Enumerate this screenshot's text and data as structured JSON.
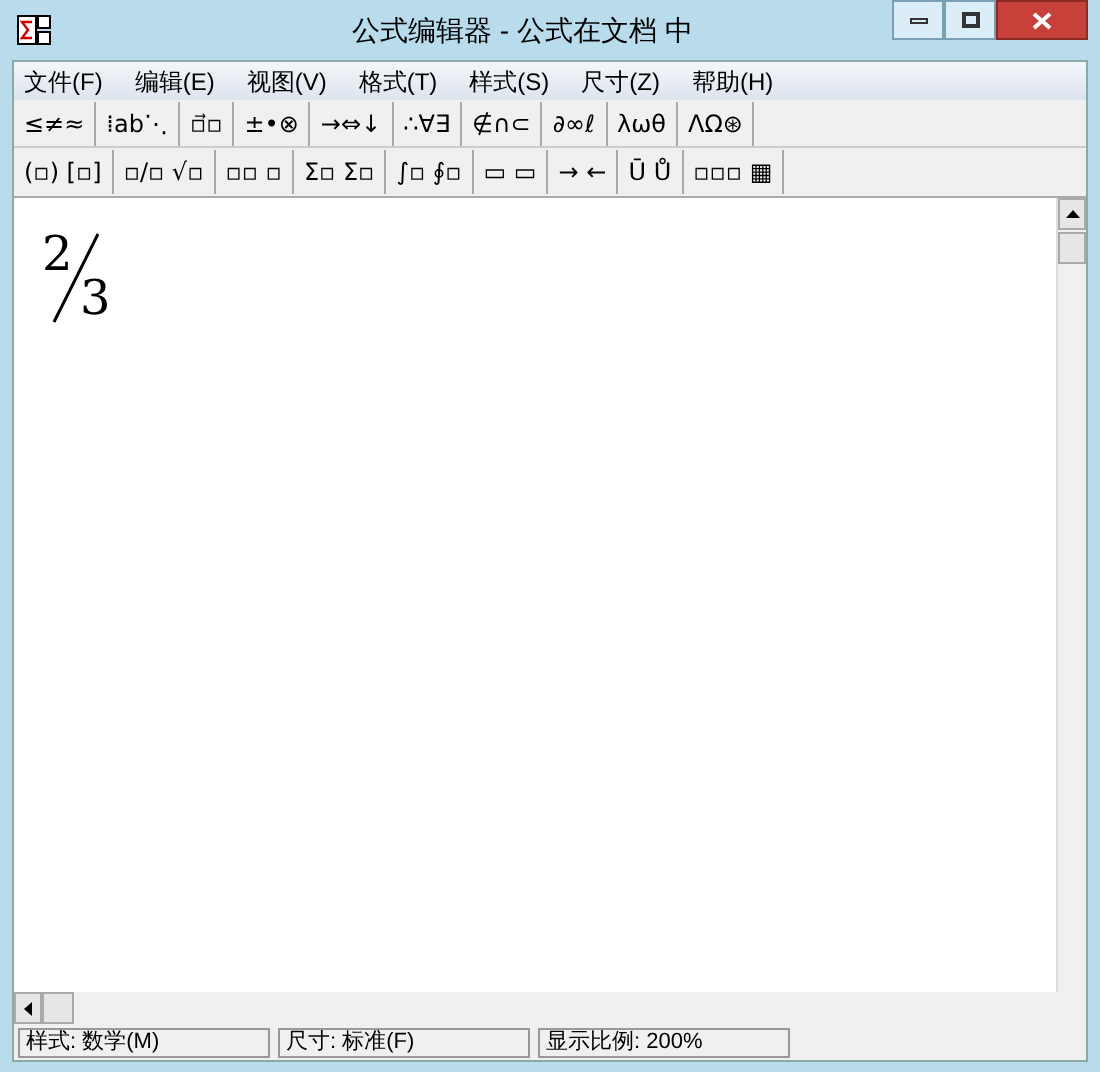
{
  "window": {
    "title": "公式编辑器 - 公式在文档 中"
  },
  "menu": [
    "文件(F)",
    "编辑(E)",
    "视图(V)",
    "格式(T)",
    "样式(S)",
    "尺寸(Z)",
    "帮助(H)"
  ],
  "toolbar_rows": [
    [
      "≤≠≈",
      "⁞ab⋱",
      "▫⃗▫",
      "±•⊗",
      "→⇔↓",
      "∴∀∃",
      "∉∩⊂",
      "∂∞ℓ",
      "λωθ",
      "ΛΩ⊛"
    ],
    [
      "(▫) [▫]",
      "▫/▫ √▫",
      "▫▫ ▫",
      "Σ▫ Σ▫",
      "∫▫ ∮▫",
      "▭ ▭",
      "→ ←",
      "Ū Ů",
      "▫▫▫ ▦"
    ]
  ],
  "equation": {
    "numerator": "2",
    "denominator": "3"
  },
  "status_bar": [
    "样式: 数学(M)",
    "尺寸: 标准(F)",
    "显示比例: 200%"
  ]
}
